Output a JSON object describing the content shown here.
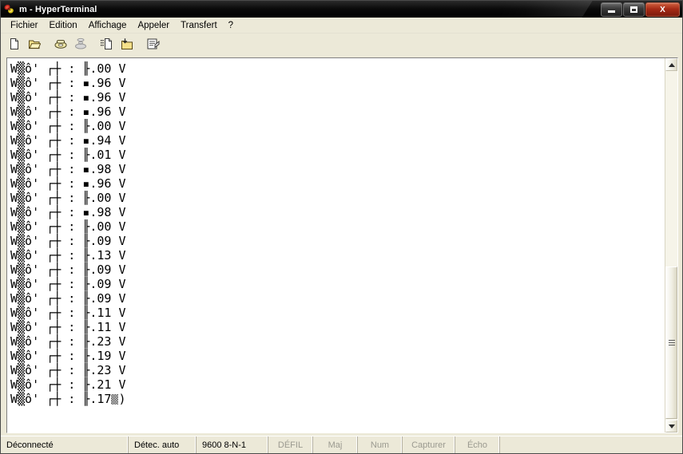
{
  "window": {
    "title": "m - HyperTerminal",
    "icon": "hyperterminal-icon",
    "controls": {
      "minimize": "minimize-button",
      "maximize": "maximize-button",
      "close_label": "X"
    }
  },
  "menu": {
    "items": [
      {
        "label": "Fichier",
        "name": "menu-fichier"
      },
      {
        "label": "Edition",
        "name": "menu-edition"
      },
      {
        "label": "Affichage",
        "name": "menu-affichage"
      },
      {
        "label": "Appeler",
        "name": "menu-appeler"
      },
      {
        "label": "Transfert",
        "name": "menu-transfert"
      },
      {
        "label": "?",
        "name": "menu-aide"
      }
    ]
  },
  "toolbar": {
    "buttons": [
      {
        "name": "new-connection-icon",
        "title": "Nouvelle connexion",
        "enabled": true
      },
      {
        "name": "open-folder-icon",
        "title": "Ouvrir",
        "enabled": true
      },
      {
        "name": "call-phone-icon",
        "title": "Appeler",
        "enabled": true
      },
      {
        "name": "hangup-phone-icon",
        "title": "Déconnecter",
        "enabled": false
      },
      {
        "name": "send-file-icon",
        "title": "Envoyer",
        "enabled": true
      },
      {
        "name": "receive-file-icon",
        "title": "Recevoir",
        "enabled": true
      },
      {
        "name": "properties-icon",
        "title": "Propriétés",
        "enabled": true
      }
    ]
  },
  "terminal": {
    "prefix": "W",
    "noise_glyph": "▒",
    "mid_glyphs": "ô' ┌┼",
    "separator": ":",
    "unit": "V",
    "cursor": "cursor-block",
    "trailing_char": ")",
    "lines": [
      {
        "lead": "╟",
        "value": ".00"
      },
      {
        "lead": "▪",
        "value": ".96"
      },
      {
        "lead": "▪",
        "value": ".96"
      },
      {
        "lead": "▪",
        "value": ".96"
      },
      {
        "lead": "╟",
        "value": ".00"
      },
      {
        "lead": "▪",
        "value": ".94"
      },
      {
        "lead": "╟",
        "value": ".01"
      },
      {
        "lead": "▪",
        "value": ".98"
      },
      {
        "lead": "▪",
        "value": ".96"
      },
      {
        "lead": "╟",
        "value": ".00"
      },
      {
        "lead": "▪",
        "value": ".98"
      },
      {
        "lead": "╟",
        "value": ".00"
      },
      {
        "lead": "╟",
        "value": ".09"
      },
      {
        "lead": "╟",
        "value": ".13"
      },
      {
        "lead": "╟",
        "value": ".09"
      },
      {
        "lead": "╟",
        "value": ".09"
      },
      {
        "lead": "╟",
        "value": ".09"
      },
      {
        "lead": "╟",
        "value": ".11"
      },
      {
        "lead": "╟",
        "value": ".11"
      },
      {
        "lead": "╟",
        "value": ".23"
      },
      {
        "lead": "╟",
        "value": ".19"
      },
      {
        "lead": "╟",
        "value": ".23"
      },
      {
        "lead": "╟",
        "value": ".21"
      },
      {
        "lead": "╟",
        "value": ".17",
        "last": true
      }
    ]
  },
  "scrollbar": {
    "up_arrow": "scroll-up-arrow",
    "down_arrow": "scroll-down-arrow",
    "thumb": "scroll-thumb"
  },
  "statusbar": {
    "connection": "Déconnecté",
    "detection": "Détec. auto",
    "rate": "9600 8-N-1",
    "indicators": [
      {
        "label": "DÉFIL",
        "name": "indicator-defil"
      },
      {
        "label": "Maj",
        "name": "indicator-maj"
      },
      {
        "label": "Num",
        "name": "indicator-num"
      },
      {
        "label": "Capturer",
        "name": "indicator-capturer"
      },
      {
        "label": "Écho",
        "name": "indicator-echo"
      }
    ]
  },
  "colors": {
    "window_face": "#ece9d8",
    "titlebar": "#000000",
    "close_button": "#a62b16",
    "terminal_bg": "#ffffff",
    "terminal_fg": "#000000",
    "status_disabled": "#9b9a90"
  }
}
